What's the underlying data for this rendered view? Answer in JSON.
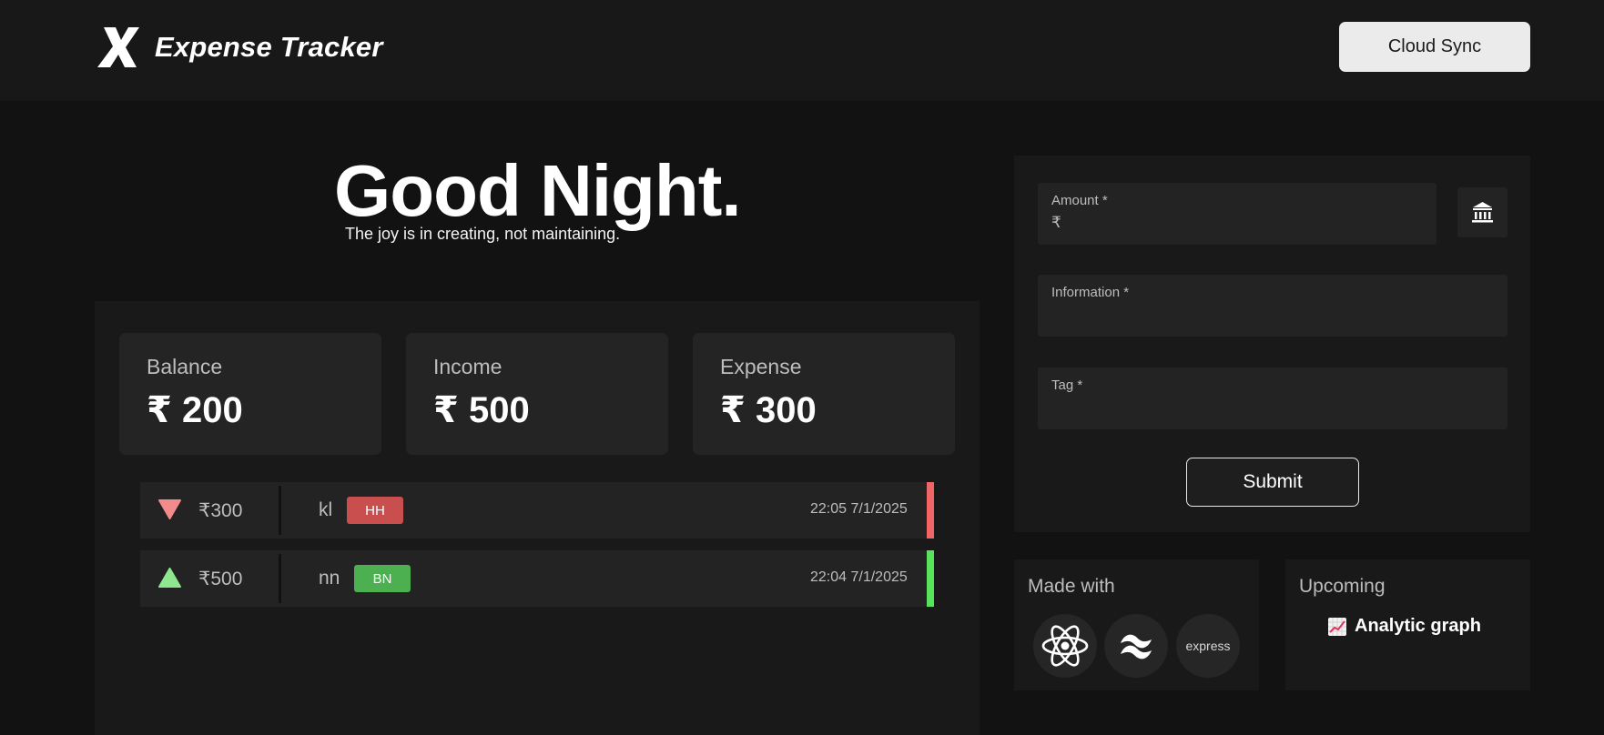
{
  "app": {
    "title": "Expense Tracker",
    "logo_icon": "x-logo-icon"
  },
  "header": {
    "cloud_sync_label": "Cloud Sync"
  },
  "hero": {
    "greeting": "Good Night.",
    "quote": "The joy is in creating, not maintaining."
  },
  "stats": [
    {
      "label": "Balance",
      "value": "₹ 200"
    },
    {
      "label": "Income",
      "value": "₹ 500"
    },
    {
      "label": "Expense",
      "value": "₹ 300"
    }
  ],
  "transactions": [
    {
      "type": "expense",
      "icon": "down-triangle-icon",
      "amount": "₹300",
      "info": "kl",
      "tag": "HH",
      "time": "22:05 7/1/2025",
      "tag_color": "#c94f4f",
      "arrow_color": "#f28b8b",
      "bar_color": "#f06565"
    },
    {
      "type": "income",
      "icon": "up-triangle-icon",
      "amount": "₹500",
      "info": "nn",
      "tag": "BN",
      "time": "22:04 7/1/2025",
      "tag_color": "#4caf50",
      "arrow_color": "#8ee68e",
      "bar_color": "#57e35a"
    }
  ],
  "form": {
    "amount_label": "Amount *",
    "currency_prefix": "₹",
    "amount_value": "",
    "information_label": "Information *",
    "information_value": "",
    "tag_label": "Tag *",
    "tag_value": "",
    "submit_label": "Submit",
    "bank_icon": "bank-icon"
  },
  "made_with": {
    "title": "Made with",
    "icons": [
      "react-icon",
      "tailwind-icon",
      "express-icon"
    ],
    "express_text": "express"
  },
  "upcoming": {
    "title": "Upcoming",
    "item_icon": "chart-increasing-icon",
    "item": "Analytic graph"
  },
  "colors": {
    "background": "#121212",
    "header": "#181818",
    "panel": "#191919",
    "card": "#232323",
    "expense": "#f06565",
    "income": "#57e35a"
  }
}
